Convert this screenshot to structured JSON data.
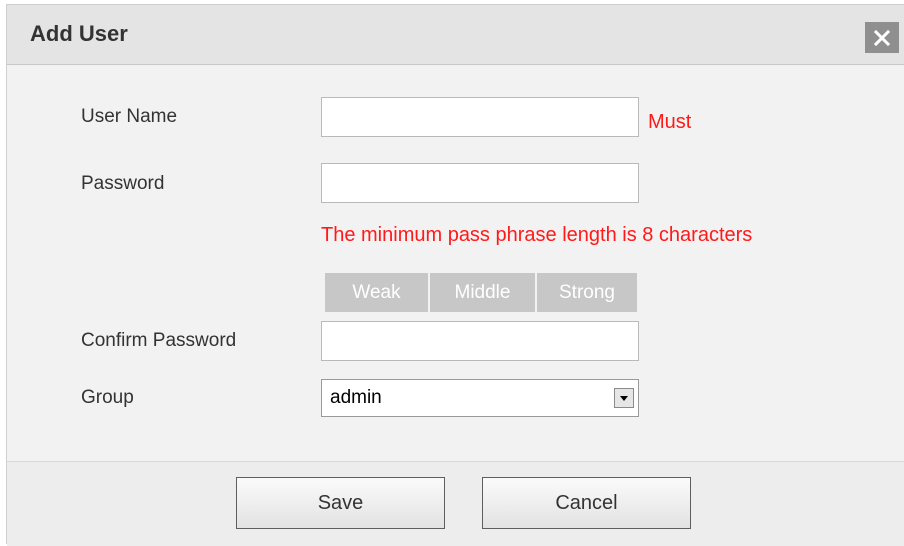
{
  "dialog": {
    "title": "Add User",
    "close_icon": "close-icon"
  },
  "form": {
    "username_label": "User Name",
    "username_value": "",
    "username_required": "Must",
    "password_label": "Password",
    "password_value": "",
    "password_hint": "The minimum pass phrase length is 8 characters",
    "strength": {
      "weak": "Weak",
      "middle": "Middle",
      "strong": "Strong"
    },
    "confirm_label": "Confirm Password",
    "confirm_value": "",
    "group_label": "Group",
    "group_value": "admin",
    "group_dropdown_icon": "chevron-down-icon"
  },
  "footer": {
    "save_label": "Save",
    "cancel_label": "Cancel"
  },
  "colors": {
    "required_text": "#ff1a1a",
    "strength_bar": "#c7c7c7",
    "close_button": "#8f8f8f"
  }
}
